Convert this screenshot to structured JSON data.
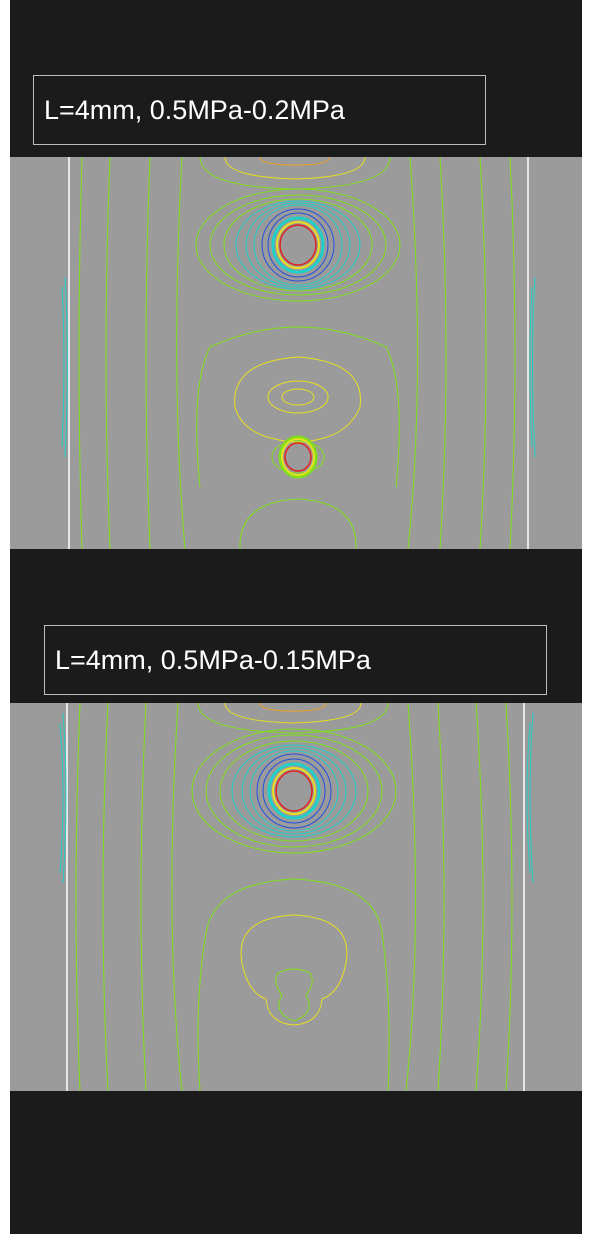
{
  "figure": {
    "panels": [
      {
        "caption": "L=4mm, 0.5MPa-0.2MPa"
      },
      {
        "caption": "L=4mm, 0.5MPa-0.15MPa"
      }
    ]
  },
  "colors": {
    "background_dark": "#1b1b1b",
    "field_gray": "#9b9b9b",
    "wall_white": "#ffffff",
    "contour_green": "#7fe01a",
    "contour_yellow": "#e8e020",
    "contour_orange": "#f0a020",
    "contour_cyan": "#20d0c8",
    "contour_blue": "#2050e0",
    "bubble_red": "#e02020"
  }
}
